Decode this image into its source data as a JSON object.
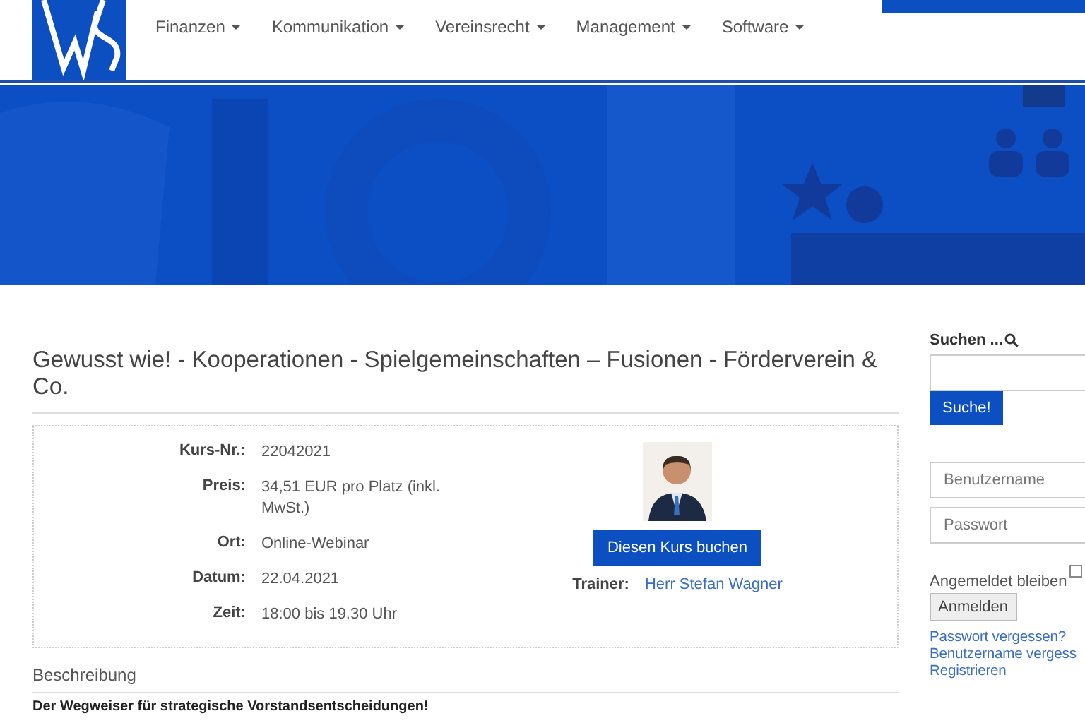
{
  "header": {
    "nav": [
      {
        "label": "Finanzen"
      },
      {
        "label": "Kommunikation"
      },
      {
        "label": "Vereinsrecht"
      },
      {
        "label": "Management"
      },
      {
        "label": "Software"
      }
    ]
  },
  "course": {
    "title": "Gewusst wie! - Kooperationen - Spielgemeinschaften – Fusionen - Förderverein & Co.",
    "fields": [
      {
        "label": "Kurs-Nr.:",
        "value": "22042021"
      },
      {
        "label": "Preis:",
        "value": "34,51 EUR pro Platz (inkl. MwSt.)"
      },
      {
        "label": "Ort:",
        "value": "Online-Webinar"
      },
      {
        "label": "Datum:",
        "value": "22.04.2021"
      },
      {
        "label": "Zeit:",
        "value": "18:00 bis 19.30 Uhr"
      }
    ],
    "book_button": "Diesen Kurs buchen",
    "trainer_label": "Trainer:",
    "trainer_name": "Herr Stefan Wagner"
  },
  "description": {
    "heading": "Beschreibung",
    "text": "Der Wegweiser für strategische Vorstandsentscheidungen!"
  },
  "sidebar": {
    "search_label": "Suchen ...",
    "search_button": "Suche!",
    "username": {
      "placeholder": "Benutzername"
    },
    "password": {
      "placeholder": "Passwort"
    },
    "remember": {
      "label": "Angemeldet bleiben",
      "checked": false
    },
    "login_button": "Anmelden",
    "links": [
      "Passwort vergessen?",
      "Benutzername vergess",
      "Registrieren"
    ]
  }
}
